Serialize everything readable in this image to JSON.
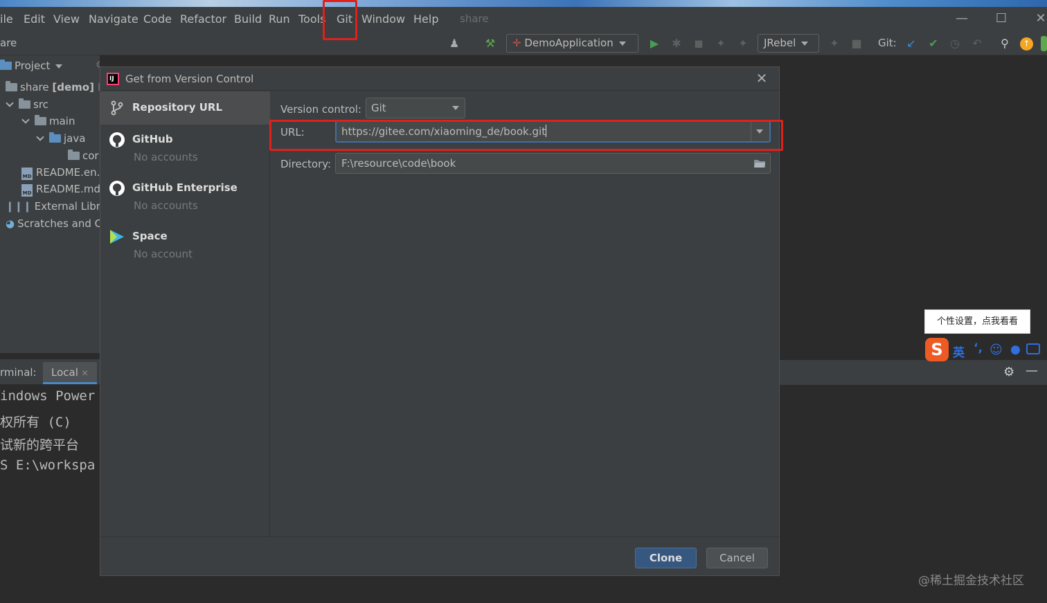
{
  "menubar": {
    "items": [
      {
        "label": "File",
        "shown": "ile"
      },
      {
        "label": "Edit"
      },
      {
        "label": "View"
      },
      {
        "label": "Navigate"
      },
      {
        "label": "Code"
      },
      {
        "label": "Refactor"
      },
      {
        "label": "Build"
      },
      {
        "label": "Run"
      },
      {
        "label": "Tools"
      },
      {
        "label": "Git"
      },
      {
        "label": "Window"
      },
      {
        "label": "Help"
      }
    ],
    "project_name": "share"
  },
  "toolbar": {
    "breadcrumb": "are",
    "run_config": "DemoApplication",
    "jrebel": "JRebel",
    "git_label": "Git:"
  },
  "project_panel": {
    "header": "Project",
    "tree": [
      {
        "label": "share",
        "suffix": "[demo]",
        "trail": "E"
      },
      {
        "label": "src"
      },
      {
        "label": "main"
      },
      {
        "label": "java"
      },
      {
        "label": "cor"
      },
      {
        "label": "README.en.r"
      },
      {
        "label": "README.md"
      },
      {
        "label": "External Librarie"
      },
      {
        "label": "Scratches and C"
      }
    ]
  },
  "terminal": {
    "label": "rminal:",
    "tab": "Local",
    "lines": [
      "indows Power",
      "权所有 (C)",
      "试新的跨平台",
      "S E:\\workspa"
    ]
  },
  "dialog": {
    "title": "Get from Version Control",
    "sidebar": [
      {
        "title": "Repository URL",
        "sub": ""
      },
      {
        "title": "GitHub",
        "sub": "No accounts"
      },
      {
        "title": "GitHub Enterprise",
        "sub": "No accounts"
      },
      {
        "title": "Space",
        "sub": "No account"
      }
    ],
    "version_control_label": "Version control:",
    "version_control_value": "Git",
    "url_label": "URL:",
    "url_value": "https://gitee.com/xiaoming_de/book.git",
    "directory_label": "Directory:",
    "directory_value": "F:\\resource\\code\\book",
    "clone_label": "Clone",
    "cancel_label": "Cancel"
  },
  "ime": {
    "tip": "个性设置，点我看看",
    "lang": "英"
  },
  "watermark": "@稀土掘金技术社区",
  "colors": {
    "accent": "#365880",
    "highlight": "#e0201b",
    "run_green": "#499c54"
  }
}
